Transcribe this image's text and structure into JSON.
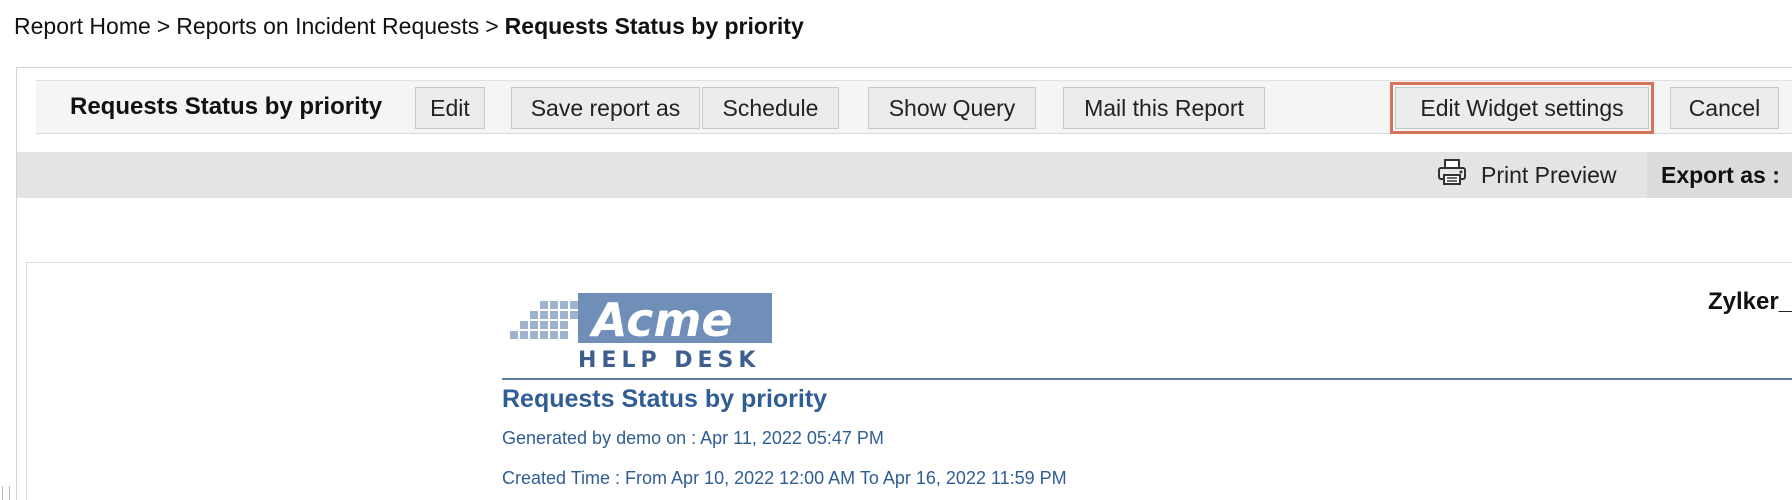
{
  "breadcrumb": {
    "home": "Report Home",
    "separator": ">",
    "parent": "Reports on Incident Requests",
    "current": "Requests Status by priority"
  },
  "toolbar": {
    "title": "Requests Status by priority",
    "buttons": {
      "edit": "Edit",
      "save_as": "Save report as",
      "schedule": "Schedule",
      "show_query": "Show Query",
      "mail": "Mail this Report",
      "edit_widget": "Edit Widget settings",
      "cancel": "Cancel"
    },
    "highlight_color": "#d9725a"
  },
  "export_bar": {
    "print_preview": "Print Preview",
    "export_as": "Export as :",
    "print_icon": "printer-icon"
  },
  "report": {
    "logo": {
      "brand": "Acme",
      "tagline": "HELP DESK",
      "brand_color": "#6f8fb8"
    },
    "company": "Zylker_",
    "title": "Requests Status by priority",
    "generated_by": "Generated by demo on : Apr 11, 2022 05:47 PM",
    "created_time": "Created Time : From Apr 10, 2022 12:00 AM To Apr 16, 2022 11:59 PM",
    "accent_color": "#2f5d94"
  }
}
